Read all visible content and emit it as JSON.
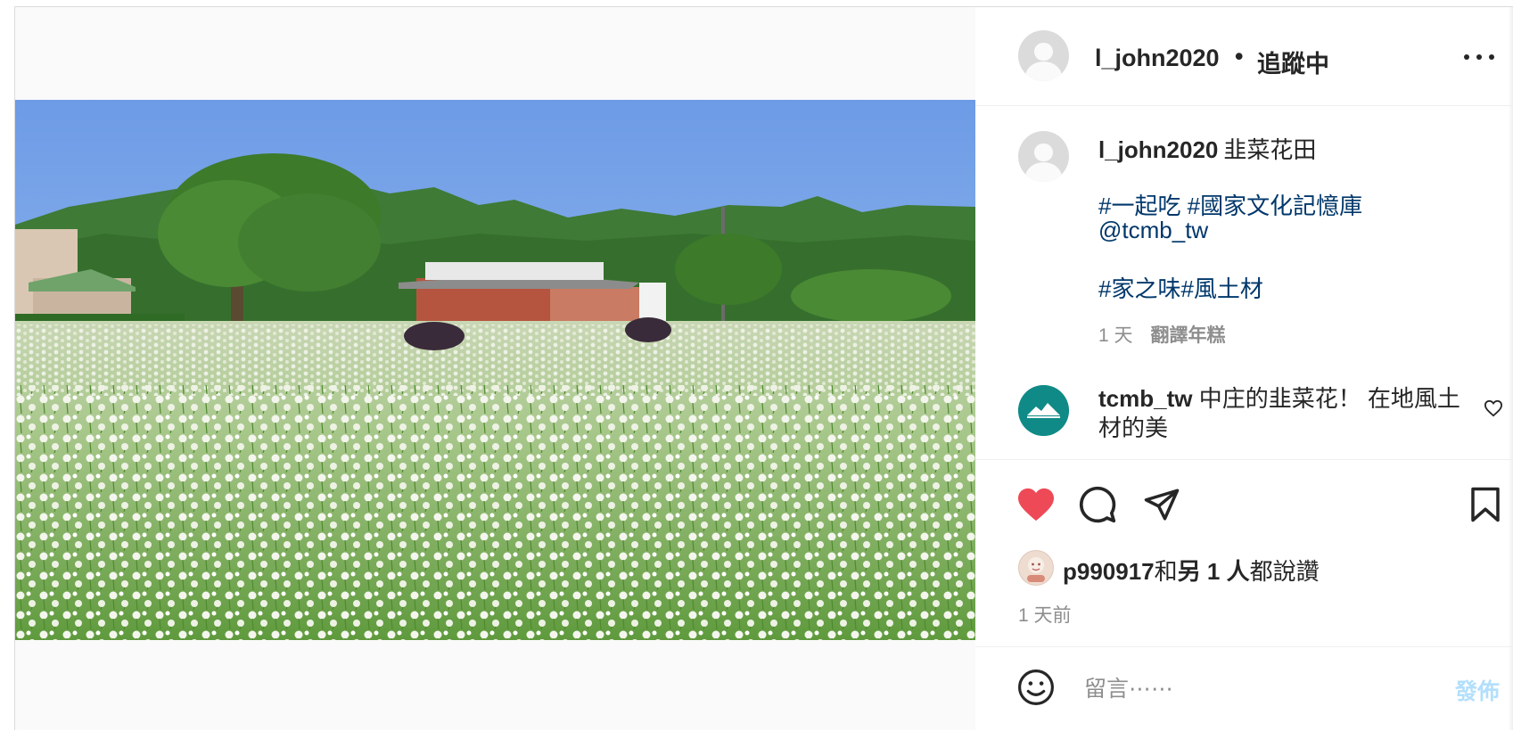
{
  "header": {
    "username": "l_john2020",
    "separator": "•",
    "follow_status": "追蹤中",
    "more_icon": "more-horizontal-icon"
  },
  "caption": {
    "username": "l_john2020",
    "text": "韭菜花田",
    "tags_line1": "#一起吃 #國家文化記憶庫",
    "mention": "@tcmb_tw",
    "tags_line2": "#家之味#風土材",
    "age": "1 天",
    "translate": "翻譯年糕"
  },
  "comment": {
    "username": "tcmb_tw",
    "text": "中庄的韭菜花！ 在地風土材的美",
    "like_icon": "heart-outline-icon"
  },
  "actions": {
    "like_icon": "heart-filled-icon",
    "comment_icon": "comment-icon",
    "share_icon": "send-icon",
    "save_icon": "bookmark-icon",
    "liked_color": "#ed4956"
  },
  "likes": {
    "user": "p990917",
    "rest_prefix": "和",
    "rest_bold": "另 1 人",
    "rest_suffix": "都說讚"
  },
  "timestamp": "1 天前",
  "comment_box": {
    "placeholder": "留言⋯⋯",
    "post_label": "發佈",
    "emoji_icon": "smiley-icon"
  },
  "colors": {
    "link": "#00376b",
    "muted": "#8e8e8e",
    "post_disabled": "#b2dffc",
    "tcmb_avatar": "#0f8a87"
  }
}
